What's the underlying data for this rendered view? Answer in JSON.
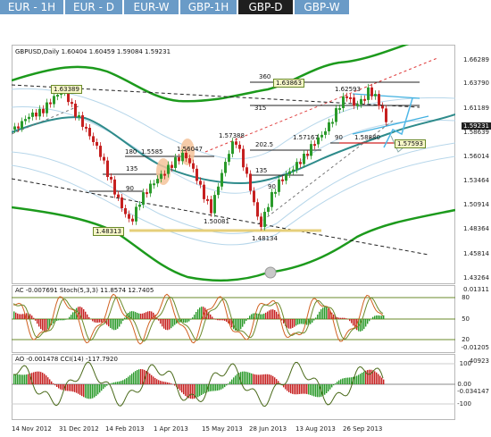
{
  "tabs": [
    {
      "label": "EUR - 1H",
      "active": false
    },
    {
      "label": "EUR - D",
      "active": false
    },
    {
      "label": "EUR-W",
      "active": false
    },
    {
      "label": "GBP-1H",
      "active": false
    },
    {
      "label": "GBP-D",
      "active": true
    },
    {
      "label": "GBP-W",
      "active": false
    }
  ],
  "price_panel": {
    "header": "GBPUSD,Daily  1.60404 1.60459 1.59084 1.59231",
    "axis_ticks": [
      "1.66289",
      "1.63790",
      "1.61189",
      "1.58639",
      "1.56014",
      "1.53464",
      "1.50914",
      "1.48364",
      "1.45814",
      "1.43264"
    ],
    "current_price": "1.59231",
    "boxed_levels": [
      "1.63389",
      "1.63863",
      "1.48313",
      "1.57593"
    ],
    "annotations": [
      "360",
      "315",
      "1.62593",
      "180",
      "1.5585",
      "1.56047",
      "1.57388",
      "135",
      "202.5",
      "1.57167",
      "90",
      "1.58880",
      "135",
      "90",
      "1.50081",
      "1.48134",
      "90"
    ]
  },
  "ac_panel": {
    "header": "AC -0.007691  Stoch(5,3,3) 11.8574 12.7405",
    "axis_ticks": [
      "0.01311",
      "80",
      "50",
      "20",
      "-0.01205"
    ]
  },
  "ao_panel": {
    "header": "AO -0.001478  CCI(14) -117.7920",
    "axis_ticks": [
      "40923",
      "100",
      "0.00",
      "-100",
      "-0.034147"
    ]
  },
  "x_axis": [
    "14 Nov 2012",
    "31 Dec 2012",
    "14 Feb 2013",
    "1 Apr 2013",
    "15 May 2013",
    "28 Jun 2013",
    "13 Aug 2013",
    "26 Sep 2013"
  ],
  "colors": {
    "tab": "#6a9bc7",
    "tab_active": "#1f1f1f",
    "bull": "#2a9a2a",
    "bear": "#c62020",
    "teal": "#2e8b8b",
    "envelope": "#1c9a1c"
  }
}
